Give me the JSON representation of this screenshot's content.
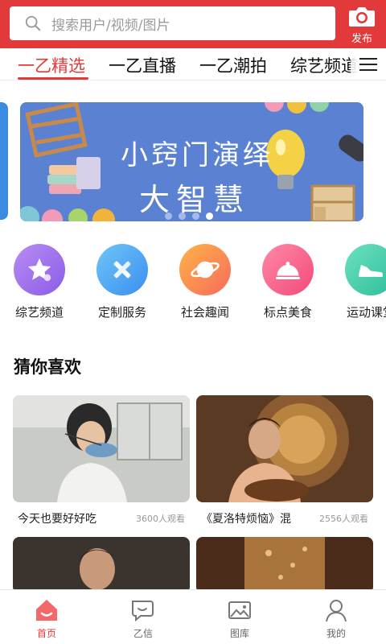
{
  "header": {
    "search_placeholder": "搜索用户/视频/图片",
    "publish_label": "发布",
    "brand_color": "#e23a3a"
  },
  "tabs": [
    {
      "label": "一乙精选",
      "active": true
    },
    {
      "label": "一乙直播",
      "active": false
    },
    {
      "label": "一乙潮拍",
      "active": false
    },
    {
      "label": "综艺频道",
      "active": false
    }
  ],
  "banner": {
    "line1": "小窍门演绎",
    "line2": "大智慧",
    "slide_count": 4,
    "active_slide": 4
  },
  "categories": [
    {
      "label": "综艺频道",
      "icon": "star-icon"
    },
    {
      "label": "定制服务",
      "icon": "tools-icon"
    },
    {
      "label": "社会趣闻",
      "icon": "planet-icon"
    },
    {
      "label": "标点美食",
      "icon": "food-cloche-icon"
    },
    {
      "label": "运动课堂",
      "icon": "sneaker-icon"
    }
  ],
  "section": {
    "title": "猜你喜欢"
  },
  "videos": [
    {
      "title": "今天也要好好吃",
      "views": "3600人观看"
    },
    {
      "title": "《夏洛特烦恼》混",
      "views": "2556人观看"
    }
  ],
  "bottom_nav": [
    {
      "label": "首页",
      "icon": "home-icon",
      "active": true
    },
    {
      "label": "乙信",
      "icon": "chat-icon",
      "active": false
    },
    {
      "label": "图库",
      "icon": "gallery-icon",
      "active": false
    },
    {
      "label": "我的",
      "icon": "user-icon",
      "active": false
    }
  ]
}
